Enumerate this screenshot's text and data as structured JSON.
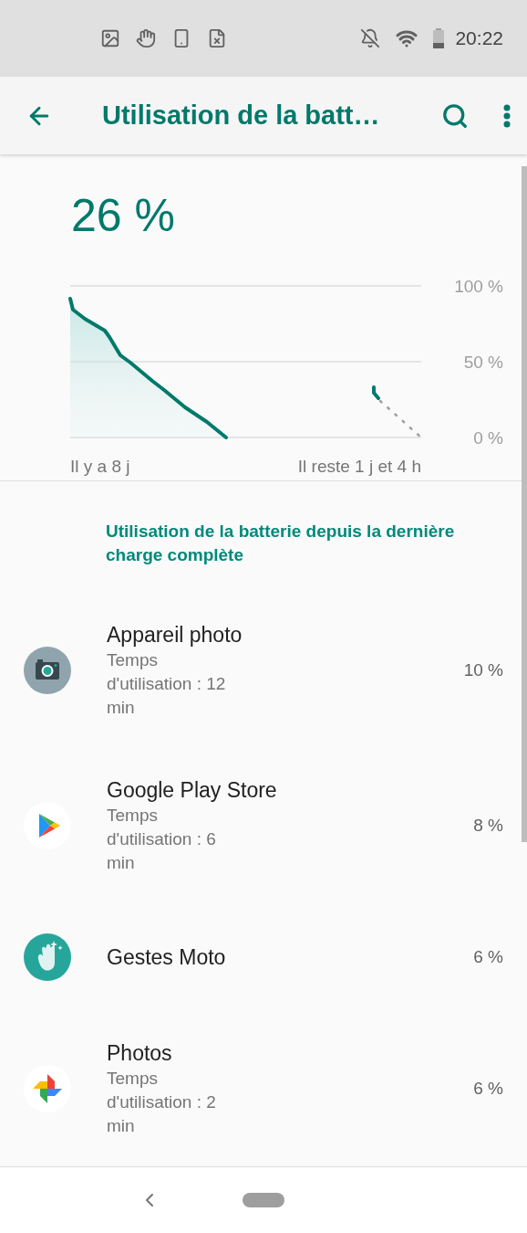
{
  "status_bar": {
    "time": "20:22"
  },
  "app_bar": {
    "title": "Utilisation de la batt…"
  },
  "battery": {
    "percent": "26 %",
    "graph": {
      "y_labels": [
        "100 %",
        "50 %",
        "0 %"
      ],
      "start_label": "Il y a 8 j",
      "end_label": "Il reste 1 j et 4 h"
    }
  },
  "usage": {
    "title": "Utilisation de la batterie depuis la dernière charge complète",
    "apps": [
      {
        "name": "Appareil photo",
        "detail": "Temps d'utilisation : 12 min",
        "percent": "10 %"
      },
      {
        "name": "Google Play Store",
        "detail": "Temps d'utilisation : 6 min",
        "percent": "8 %"
      },
      {
        "name": "Gestes Moto",
        "percent": "6 %"
      },
      {
        "name": "Photos",
        "detail": "Temps d'utilisation : 2 min",
        "percent": "6 %"
      }
    ]
  }
}
